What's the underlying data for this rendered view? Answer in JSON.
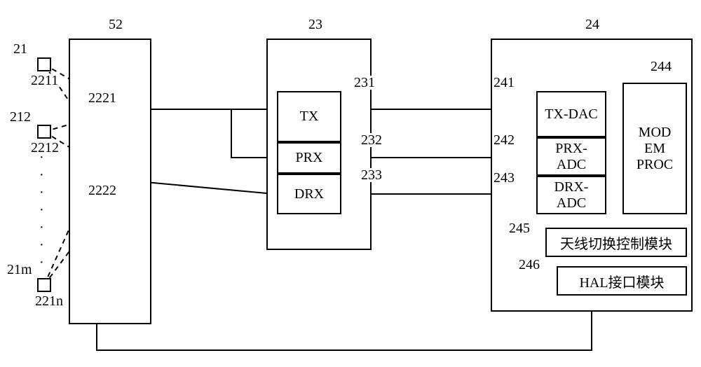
{
  "top": {
    "switch_title": "52",
    "transceiver_title": "23",
    "baseband_title": "24"
  },
  "antennas": {
    "a1": "21",
    "a1_inner": "2211",
    "a2": "212",
    "a2_inner": "2212",
    "am": "21m",
    "am_inner": "221n"
  },
  "switch_ports": {
    "p1": "2221",
    "p2": "2222"
  },
  "transceiver": {
    "tx_id": "231",
    "tx": "TX",
    "prx_id": "232",
    "prx": "PRX",
    "drx_id": "233",
    "drx": "DRX"
  },
  "baseband": {
    "txdac_id": "241",
    "txdac": "TX-DAC",
    "prxadc_id": "242",
    "prxadc": "PRX-\nADC",
    "drxadc_id": "243",
    "drxadc": "DRX-\nADC",
    "modem_id": "244",
    "modem": "MOD\nEM\nPROC",
    "ctrl_id": "245",
    "ctrl": "天线切换控制模块",
    "hal_id": "246",
    "hal": "HAL接口模块"
  }
}
